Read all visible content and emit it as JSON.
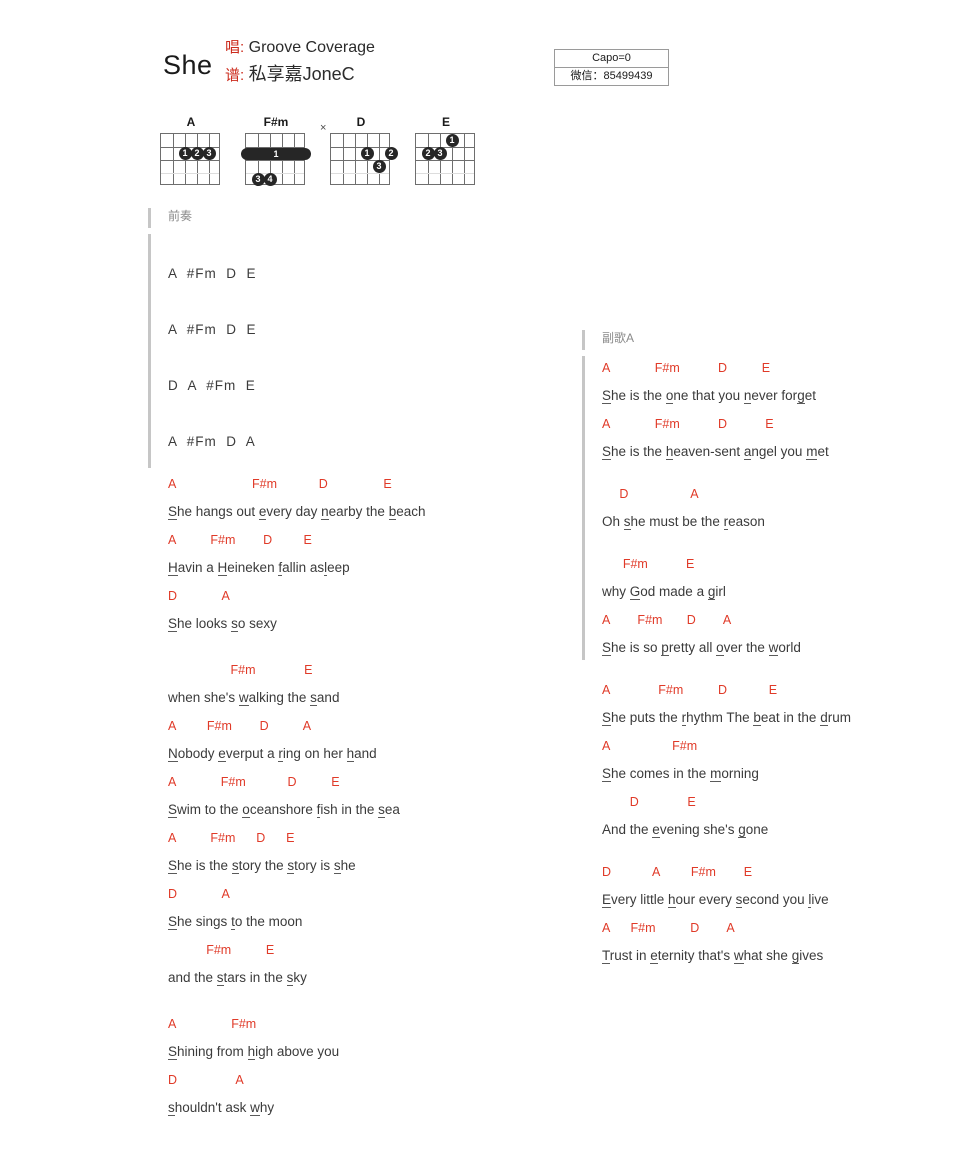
{
  "header": {
    "title": "She",
    "singer_key": "唱:",
    "singer_value": "Groove Coverage",
    "arranger_key": "谱:",
    "arranger_value": "私享嘉JoneC",
    "capo": "Capo=0",
    "wechat": "微信：85499439"
  },
  "chord_diagrams": [
    {
      "name": "A",
      "strings": 6,
      "frets": 4,
      "mute": [],
      "dots": [
        {
          "string": 4,
          "fret": 2,
          "finger": "1"
        },
        {
          "string": 3,
          "fret": 2,
          "finger": "2"
        },
        {
          "string": 2,
          "fret": 2,
          "finger": "3"
        }
      ],
      "barres": []
    },
    {
      "name": "F#m",
      "strings": 6,
      "frets": 4,
      "mute": [],
      "dots": [
        {
          "string": 5,
          "fret": 4,
          "finger": "3"
        },
        {
          "string": 4,
          "fret": 4,
          "finger": "4"
        }
      ],
      "barres": [
        {
          "fret": 2,
          "from_string": 6,
          "to_string": 1,
          "finger": "1"
        }
      ]
    },
    {
      "name": "D",
      "strings": 6,
      "frets": 4,
      "mute": [
        6
      ],
      "dots": [
        {
          "string": 3,
          "fret": 2,
          "finger": "1"
        },
        {
          "string": 1,
          "fret": 2,
          "finger": "2"
        },
        {
          "string": 2,
          "fret": 3,
          "finger": "3"
        }
      ],
      "barres": []
    },
    {
      "name": "E",
      "strings": 6,
      "frets": 4,
      "mute": [],
      "dots": [
        {
          "string": 3,
          "fret": 1,
          "finger": "1"
        },
        {
          "string": 5,
          "fret": 2,
          "finger": "2"
        },
        {
          "string": 4,
          "fret": 2,
          "finger": "3"
        }
      ],
      "barres": []
    }
  ],
  "left_column": {
    "section_label": "前奏",
    "intro_lines": [
      "A  #Fm  D  E",
      "A  #Fm  D  E",
      "D  A  #Fm  E",
      "A  #Fm  D  A"
    ],
    "verse": [
      {
        "chords": "A                      F#m            D                E",
        "lyrics_plain": "She hangs out every day nearby the beach",
        "lyrics_segments": [
          {
            "t": "S",
            "u": true
          },
          {
            "t": "he hangs out ",
            "u": false
          },
          {
            "t": "e",
            "u": true
          },
          {
            "t": "very day ",
            "u": false
          },
          {
            "t": "n",
            "u": true
          },
          {
            "t": "earby the ",
            "u": false
          },
          {
            "t": "b",
            "u": true
          },
          {
            "t": "each",
            "u": false
          }
        ]
      },
      {
        "chords": "A          F#m        D         E",
        "lyrics_plain": "Havin a Heineken fallin asleep",
        "lyrics_segments": [
          {
            "t": "H",
            "u": true
          },
          {
            "t": "avin a ",
            "u": false
          },
          {
            "t": "H",
            "u": true
          },
          {
            "t": "eineken ",
            "u": false
          },
          {
            "t": "f",
            "u": true
          },
          {
            "t": "allin as",
            "u": false
          },
          {
            "t": "l",
            "u": true
          },
          {
            "t": "eep",
            "u": false
          }
        ]
      },
      {
        "chords": "D             A",
        "lyrics_plain": "She looks so sexy",
        "lyrics_segments": [
          {
            "t": "S",
            "u": true
          },
          {
            "t": "he looks ",
            "u": false
          },
          {
            "t": "s",
            "u": true
          },
          {
            "t": "o sexy",
            "u": false
          }
        ]
      },
      {
        "chords": "                  F#m              E",
        "lyrics_plain": "when she's walking the sand",
        "lyrics_segments": [
          {
            "t": "when she's ",
            "u": false
          },
          {
            "t": "w",
            "u": true
          },
          {
            "t": "alking the ",
            "u": false
          },
          {
            "t": "s",
            "u": true
          },
          {
            "t": "and",
            "u": false
          }
        ]
      },
      {
        "chords": "A         F#m        D          A",
        "lyrics_plain": "Nobody everput a ring on her hand",
        "lyrics_segments": [
          {
            "t": "N",
            "u": true
          },
          {
            "t": "obody ",
            "u": false
          },
          {
            "t": "e",
            "u": true
          },
          {
            "t": "verput a ",
            "u": false
          },
          {
            "t": "r",
            "u": true
          },
          {
            "t": "ing on her ",
            "u": false
          },
          {
            "t": "h",
            "u": true
          },
          {
            "t": "and",
            "u": false
          }
        ]
      },
      {
        "chords": "A             F#m            D          E",
        "lyrics_plain": "Swim to the oceanshore fish in the sea",
        "lyrics_segments": [
          {
            "t": "S",
            "u": true
          },
          {
            "t": "wim to the ",
            "u": false
          },
          {
            "t": "o",
            "u": true
          },
          {
            "t": "ceanshore ",
            "u": false
          },
          {
            "t": "f",
            "u": true
          },
          {
            "t": "ish in the ",
            "u": false
          },
          {
            "t": "s",
            "u": true
          },
          {
            "t": "ea",
            "u": false
          }
        ]
      },
      {
        "chords": "A          F#m      D      E",
        "lyrics_plain": "She is the story the story is she",
        "lyrics_segments": [
          {
            "t": "S",
            "u": true
          },
          {
            "t": "he is the ",
            "u": false
          },
          {
            "t": "s",
            "u": true
          },
          {
            "t": "tory the ",
            "u": false
          },
          {
            "t": "s",
            "u": true
          },
          {
            "t": "tory is ",
            "u": false
          },
          {
            "t": "s",
            "u": true
          },
          {
            "t": "he",
            "u": false
          }
        ]
      },
      {
        "chords": "D             A",
        "lyrics_plain": "She sings to the moon",
        "lyrics_segments": [
          {
            "t": "S",
            "u": true
          },
          {
            "t": "he sings ",
            "u": false
          },
          {
            "t": "t",
            "u": true
          },
          {
            "t": "o the moon",
            "u": false
          }
        ]
      },
      {
        "chords": "           F#m          E",
        "lyrics_plain": "and the stars in the sky",
        "lyrics_segments": [
          {
            "t": "and the ",
            "u": false
          },
          {
            "t": "s",
            "u": true
          },
          {
            "t": "tars in the ",
            "u": false
          },
          {
            "t": "s",
            "u": true
          },
          {
            "t": "ky",
            "u": false
          }
        ]
      },
      {
        "chords": "A                F#m",
        "lyrics_plain": "Shining from high above you",
        "lyrics_segments": [
          {
            "t": "S",
            "u": true
          },
          {
            "t": "hining from ",
            "u": false
          },
          {
            "t": "h",
            "u": true
          },
          {
            "t": "igh above you",
            "u": false
          }
        ]
      },
      {
        "chords": "D                 A",
        "lyrics_plain": "shouldn't ask why",
        "lyrics_segments": [
          {
            "t": "s",
            "u": true
          },
          {
            "t": "houldn't ask ",
            "u": false
          },
          {
            "t": "w",
            "u": true
          },
          {
            "t": "hy",
            "u": false
          }
        ]
      }
    ]
  },
  "right_column": {
    "section_label": "副歌A",
    "chorus": [
      {
        "chords": "A             F#m           D          E",
        "lyrics_plain": "She is the one that you never forget",
        "lyrics_segments": [
          {
            "t": "S",
            "u": true
          },
          {
            "t": "he is the ",
            "u": false
          },
          {
            "t": "o",
            "u": true
          },
          {
            "t": "ne that you ",
            "u": false
          },
          {
            "t": "n",
            "u": true
          },
          {
            "t": "ever for",
            "u": false
          },
          {
            "t": "g",
            "u": true
          },
          {
            "t": "et",
            "u": false
          }
        ]
      },
      {
        "chords": "A             F#m           D           E",
        "lyrics_plain": "She is the heaven-sent angel you met",
        "lyrics_segments": [
          {
            "t": "S",
            "u": true
          },
          {
            "t": "he is the ",
            "u": false
          },
          {
            "t": "h",
            "u": true
          },
          {
            "t": "eaven-sent ",
            "u": false
          },
          {
            "t": "a",
            "u": true
          },
          {
            "t": "ngel you ",
            "u": false
          },
          {
            "t": "m",
            "u": true
          },
          {
            "t": "et",
            "u": false
          }
        ]
      },
      {
        "chords": "     D                  A",
        "lyrics_plain": "Oh she must be the reason",
        "lyrics_segments": [
          {
            "t": "Oh ",
            "u": false
          },
          {
            "t": "s",
            "u": true
          },
          {
            "t": "he must be the ",
            "u": false
          },
          {
            "t": "r",
            "u": true
          },
          {
            "t": "eason",
            "u": false
          }
        ]
      },
      {
        "chords": "      F#m           E",
        "lyrics_plain": "why God made a girl",
        "lyrics_segments": [
          {
            "t": "why ",
            "u": false
          },
          {
            "t": "G",
            "u": true
          },
          {
            "t": "od made a ",
            "u": false
          },
          {
            "t": "g",
            "u": true
          },
          {
            "t": "irl",
            "u": false
          }
        ]
      },
      {
        "chords": "A        F#m       D        A",
        "lyrics_plain": "She is so pretty all over the world",
        "lyrics_segments": [
          {
            "t": "S",
            "u": true
          },
          {
            "t": "he is so ",
            "u": false
          },
          {
            "t": "p",
            "u": true
          },
          {
            "t": "retty all ",
            "u": false
          },
          {
            "t": "o",
            "u": true
          },
          {
            "t": "ver the ",
            "u": false
          },
          {
            "t": "w",
            "u": true
          },
          {
            "t": "orld",
            "u": false
          }
        ]
      },
      {
        "chords": "A              F#m          D            E",
        "lyrics_plain": "She puts the rhythm The beat in the drum",
        "lyrics_segments": [
          {
            "t": "S",
            "u": true
          },
          {
            "t": "he puts the ",
            "u": false
          },
          {
            "t": "r",
            "u": true
          },
          {
            "t": "hythm The ",
            "u": false
          },
          {
            "t": "b",
            "u": true
          },
          {
            "t": "eat in the ",
            "u": false
          },
          {
            "t": "d",
            "u": true
          },
          {
            "t": "rum",
            "u": false
          }
        ]
      },
      {
        "chords": "A                  F#m",
        "lyrics_plain": "She comes in the morning",
        "lyrics_segments": [
          {
            "t": "S",
            "u": true
          },
          {
            "t": "he comes in the ",
            "u": false
          },
          {
            "t": "m",
            "u": true
          },
          {
            "t": "orning",
            "u": false
          }
        ]
      },
      {
        "chords": "        D              E",
        "lyrics_plain": "And the evening she's gone",
        "lyrics_segments": [
          {
            "t": "And the ",
            "u": false
          },
          {
            "t": "e",
            "u": true
          },
          {
            "t": "vening she's ",
            "u": false
          },
          {
            "t": "g",
            "u": true
          },
          {
            "t": "one",
            "u": false
          }
        ]
      },
      {
        "chords": "D            A         F#m        E",
        "lyrics_plain": "Every little hour every second you live",
        "lyrics_segments": [
          {
            "t": "E",
            "u": true
          },
          {
            "t": "very little ",
            "u": false
          },
          {
            "t": "h",
            "u": true
          },
          {
            "t": "our every ",
            "u": false
          },
          {
            "t": "s",
            "u": true
          },
          {
            "t": "econd you ",
            "u": false
          },
          {
            "t": "l",
            "u": true
          },
          {
            "t": "ive",
            "u": false
          }
        ]
      },
      {
        "chords": "A      F#m          D        A",
        "lyrics_plain": "Trust in eternity that's what she gives",
        "lyrics_segments": [
          {
            "t": "T",
            "u": true
          },
          {
            "t": "rust in ",
            "u": false
          },
          {
            "t": "e",
            "u": true
          },
          {
            "t": "ternity that's ",
            "u": false
          },
          {
            "t": "w",
            "u": true
          },
          {
            "t": "hat she ",
            "u": false
          },
          {
            "t": "g",
            "u": true
          },
          {
            "t": "ives",
            "u": false
          }
        ]
      }
    ]
  },
  "colors": {
    "chord_red": "#e03a28",
    "lyric_gray": "#3b3b3b",
    "section_bar": "#c6c6c6",
    "section_label": "#8a8a8a"
  }
}
